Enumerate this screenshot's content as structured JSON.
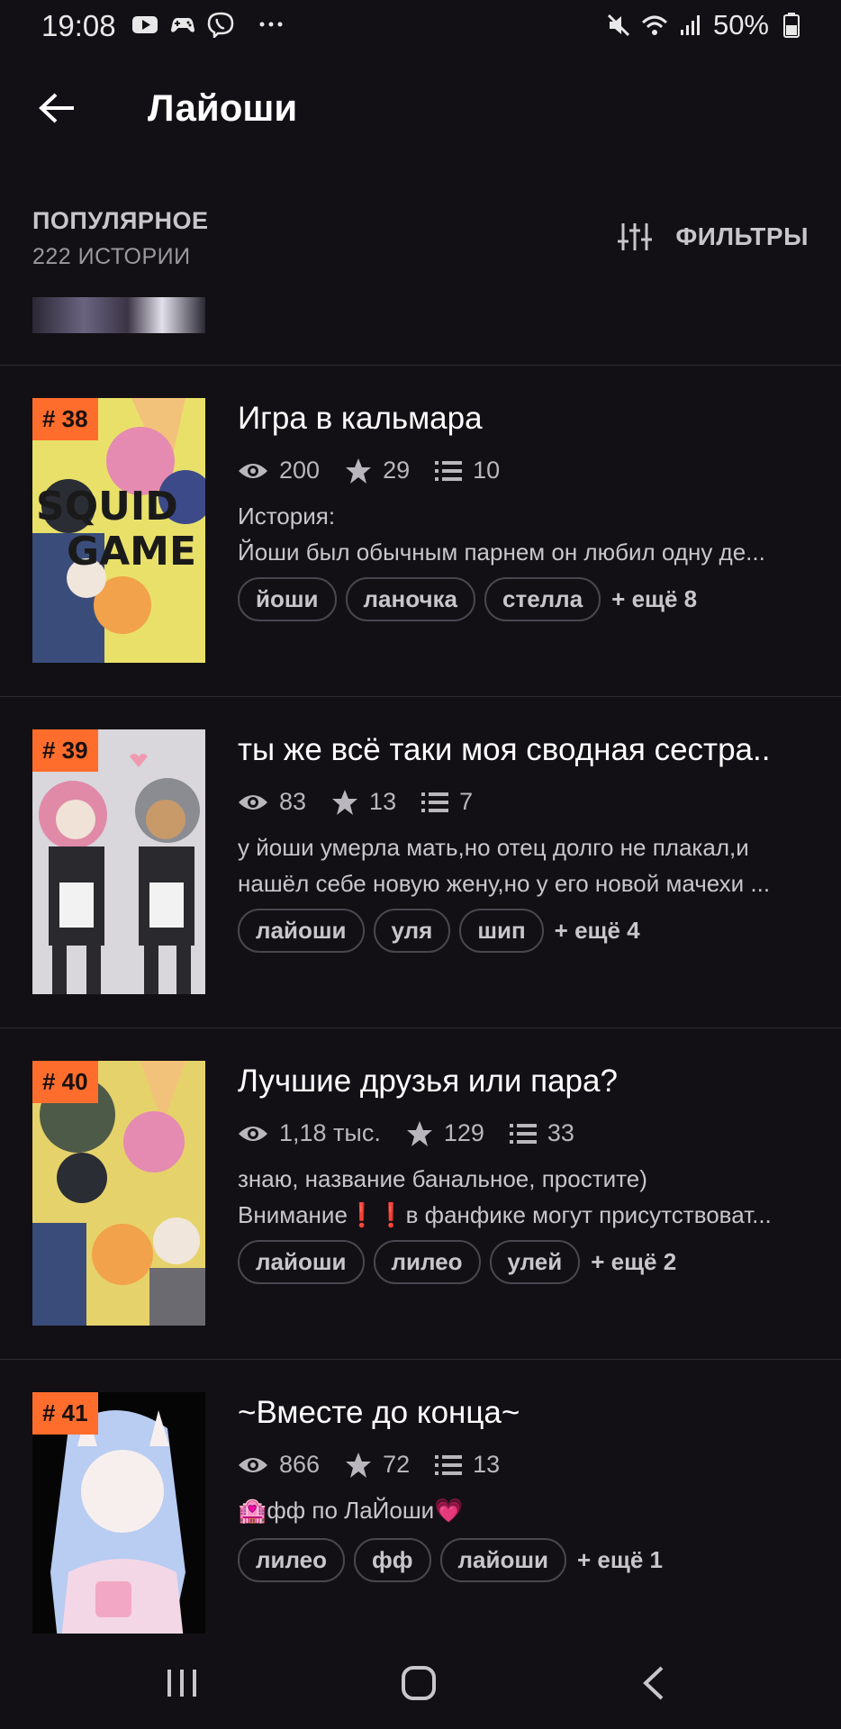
{
  "status_bar": {
    "time": "19:08",
    "battery": "50%",
    "left_icons": [
      "youtube-icon",
      "game-controller-icon",
      "viber-icon",
      "more-dots-icon"
    ],
    "right_icons": [
      "mute-icon",
      "wifi-icon",
      "signal-icon",
      "battery-icon"
    ]
  },
  "header": {
    "title": "Лайоши",
    "back_icon": "arrow-left-icon"
  },
  "sort": {
    "label": "ПОПУЛЯРНОЕ",
    "count": "222 ИСТОРИИ",
    "filters_label": "ФИЛЬТРЫ",
    "filters_icon": "sliders-icon"
  },
  "colors": {
    "background": "#121014",
    "rank_badge": "#ff6d2c",
    "divider": "#2e2b33"
  },
  "stories": [
    {
      "rank": "# 38",
      "title": "Игра в кальмара",
      "views": "200",
      "votes": "29",
      "parts": "10",
      "desc_lines": [
        "История:",
        "Йоши был обычным парнем он любил одну де..."
      ],
      "tags": [
        "йоши",
        "ланочка",
        "стелла"
      ],
      "more": "+ ещё 8"
    },
    {
      "rank": "# 39",
      "title": "ты же всё таки моя сводная сестра..",
      "views": "83",
      "votes": "13",
      "parts": "7",
      "desc_lines": [
        "у йоши умерла мать,но отец долго не плакал,и",
        "нашёл себе новую жену,но у его новой мачехи ..."
      ],
      "tags": [
        "лайоши",
        "уля",
        "шип"
      ],
      "more": "+ ещё 4"
    },
    {
      "rank": "# 40",
      "title": "Лучшие друзья или пара?",
      "views": "1,18 тыс.",
      "votes": "129",
      "parts": "33",
      "desc_lines": [
        "знаю, название банальное, простите)",
        "Внимание❗❗в фанфике могут присутствоват..."
      ],
      "tags": [
        "лайоши",
        "лилео",
        "улей"
      ],
      "more": "+ ещё 2"
    },
    {
      "rank": "# 41",
      "title": "~Вместе до конца~",
      "views": "866",
      "votes": "72",
      "parts": "13",
      "desc_lines": [
        "🏩фф по ЛаЙоши💗"
      ],
      "tags": [
        "лилео",
        "фф",
        "лайоши"
      ],
      "more": "+ ещё 1"
    }
  ],
  "nav": {
    "recents_icon": "recent-apps-icon",
    "home_icon": "home-icon",
    "back_icon": "back-chevron-icon"
  }
}
